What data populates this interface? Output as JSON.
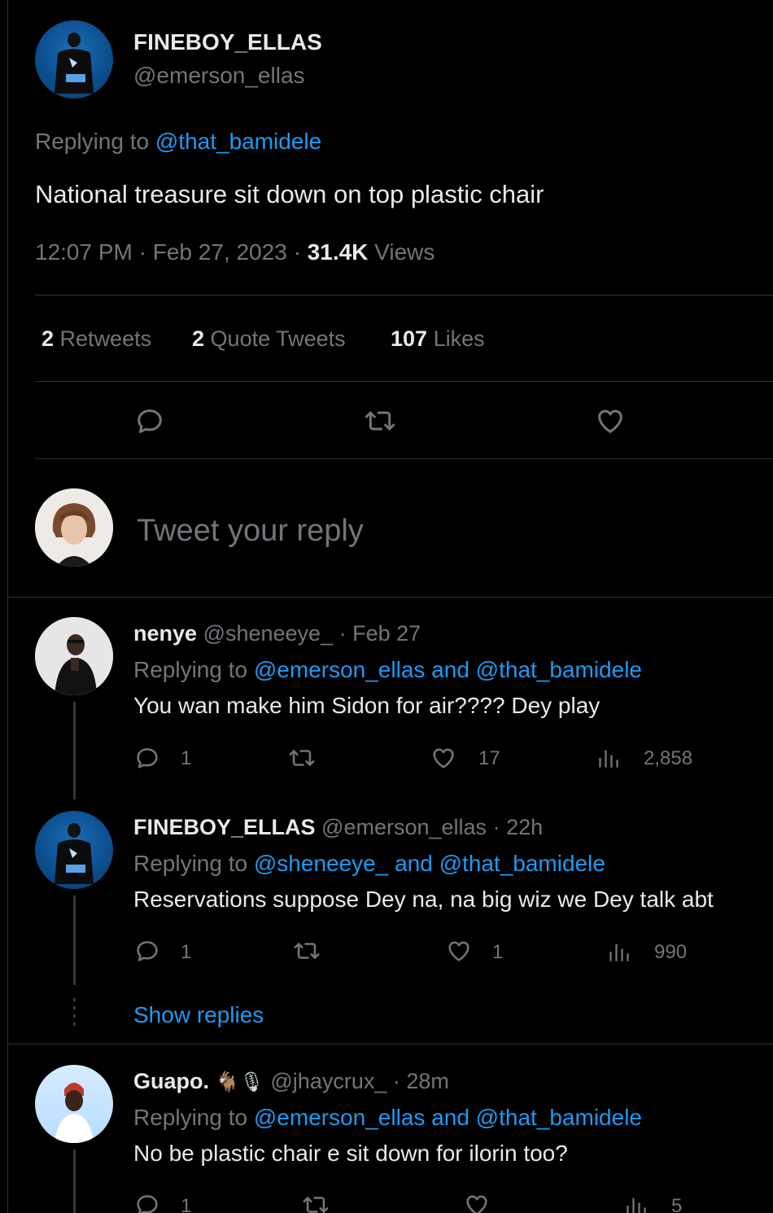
{
  "main_tweet": {
    "display_name": "FINEBOY_ELLAS",
    "handle": "@emerson_ellas",
    "replying_prefix": "Replying to",
    "replying_to": "@that_bamidele",
    "text": "National treasure sit down on top plastic chair",
    "time": "12:07 PM",
    "sep1": "·",
    "date": "Feb 27, 2023",
    "sep2": "·",
    "views_count": "31.4K",
    "views_label": "Views",
    "retweets_count": "2",
    "retweets_label": "Retweets",
    "quotes_count": "2",
    "quotes_label": "Quote Tweets",
    "likes_count": "107",
    "likes_label": "Likes"
  },
  "composer": {
    "placeholder": "Tweet your reply"
  },
  "replies": [
    {
      "display_name": "nenye",
      "handle": "@sheneeye_",
      "sep": "·",
      "time": "Feb 27",
      "replying_prefix": "Replying to",
      "replying_to": "@emerson_ellas and @that_bamidele",
      "text": "You wan make him Sidon for air???? Dey play",
      "reply_count": "1",
      "like_count": "17",
      "view_count": "2,858"
    },
    {
      "display_name": "FINEBOY_ELLAS",
      "handle": "@emerson_ellas",
      "sep": "·",
      "time": "22h",
      "replying_prefix": "Replying to",
      "replying_to": "@sheneeye_ and @that_bamidele",
      "text": "Reservations suppose Dey na, na big wiz we Dey talk abt",
      "reply_count": "1",
      "like_count": "1",
      "view_count": "990"
    },
    {
      "display_name": "Guapo.",
      "emoji": "🐐🎙",
      "handle": "@jhaycrux_",
      "sep": "·",
      "time": "28m",
      "replying_prefix": "Replying to",
      "replying_to": "@emerson_ellas and @that_bamidele",
      "text": "No be plastic chair e sit down for ilorin too?",
      "reply_count": "1",
      "like_count": "",
      "view_count": "5"
    }
  ],
  "show_replies": "Show replies",
  "colors": {
    "background": "#000000",
    "text": "#e7e9ea",
    "muted": "#71767b",
    "accent": "#1d9bf0",
    "divider": "#2f3336"
  }
}
